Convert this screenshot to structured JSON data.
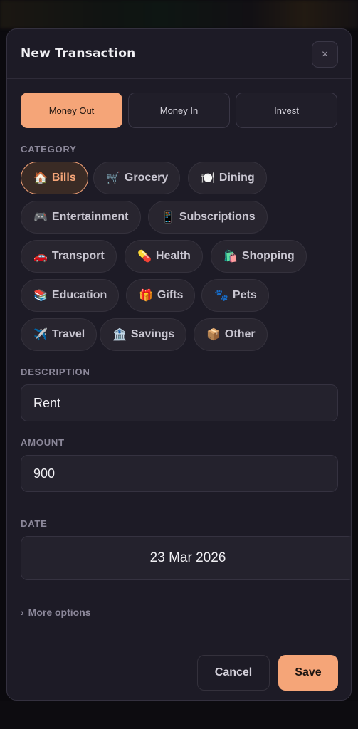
{
  "modal": {
    "title": "New Transaction",
    "close_label": "×"
  },
  "transaction_type": {
    "options": [
      "Money Out",
      "Money In",
      "Invest"
    ],
    "selected": "Money Out"
  },
  "category": {
    "label": "CATEGORY",
    "selected": "Bills",
    "items": [
      {
        "emoji": "🏠",
        "label": "Bills"
      },
      {
        "emoji": "🛒",
        "label": "Grocery"
      },
      {
        "emoji": "🍽️",
        "label": "Dining"
      },
      {
        "emoji": "🎮",
        "label": "Entertainment"
      },
      {
        "emoji": "📱",
        "label": "Subscriptions"
      },
      {
        "emoji": "🚗",
        "label": "Transport"
      },
      {
        "emoji": "💊",
        "label": "Health"
      },
      {
        "emoji": "🛍️",
        "label": "Shopping"
      },
      {
        "emoji": "📚",
        "label": "Education"
      },
      {
        "emoji": "🎁",
        "label": "Gifts"
      },
      {
        "emoji": "🐾",
        "label": "Pets"
      },
      {
        "emoji": "✈️",
        "label": "Travel"
      },
      {
        "emoji": "🏦",
        "label": "Savings"
      },
      {
        "emoji": "📦",
        "label": "Other"
      }
    ]
  },
  "description": {
    "label": "DESCRIPTION",
    "value": "Rent"
  },
  "amount": {
    "label": "AMOUNT",
    "value": "900"
  },
  "date": {
    "label": "DATE",
    "value": "23 Mar 2026"
  },
  "more_options": {
    "chevron": "›",
    "label": "More options"
  },
  "footer": {
    "cancel_label": "Cancel",
    "save_label": "Save"
  },
  "colors": {
    "accent": "#f5a578",
    "background": "#1d1b26"
  }
}
